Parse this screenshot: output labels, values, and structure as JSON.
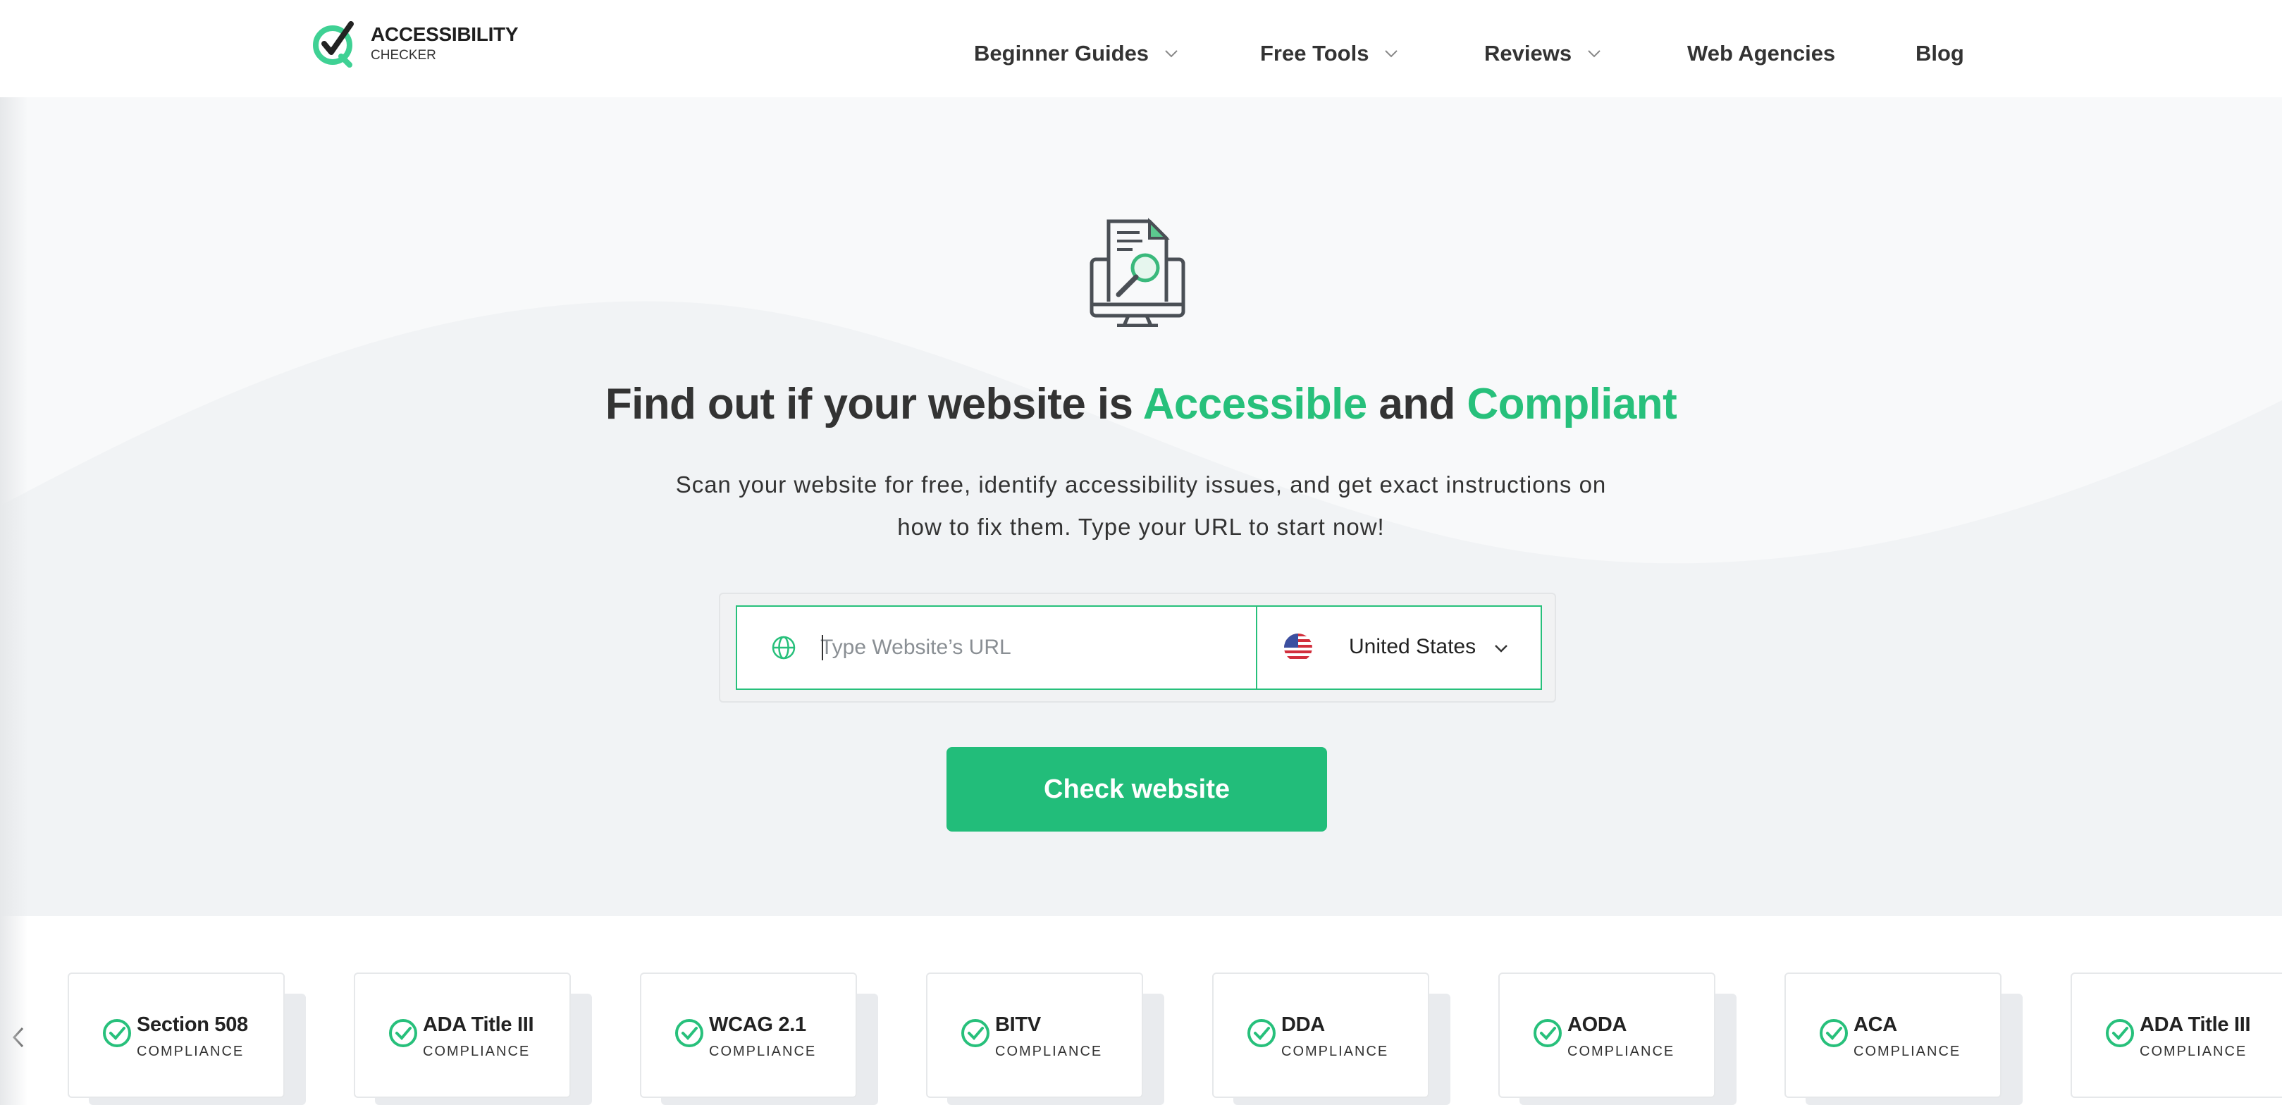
{
  "brand": {
    "title": "ACCESSIBILITY",
    "subtitle": "CHECKER",
    "logo_icon": "checkmark-q-logo",
    "accent": "#27c07b"
  },
  "nav": {
    "items": [
      {
        "label": "Beginner Guides",
        "dropdown": true
      },
      {
        "label": "Free Tools",
        "dropdown": true
      },
      {
        "label": "Reviews",
        "dropdown": true
      },
      {
        "label": "Web Agencies",
        "dropdown": false
      },
      {
        "label": "Blog",
        "dropdown": false
      }
    ]
  },
  "hero": {
    "icon": "monitor-document-search-icon",
    "headline_prefix": "Find out if your website is",
    "headline_accent1": "Accessible",
    "headline_mid": "and",
    "headline_accent2": "Compliant",
    "subtext_line1": "Scan your website for free, identify accessibility issues, and get exact instructions on",
    "subtext_line2": "how to fix them. Type your URL to start now!"
  },
  "form": {
    "url_placeholder": "Type Website’s URL",
    "url_value": "",
    "country": "United States",
    "country_flag": "us-flag-icon",
    "submit_label": "Check website"
  },
  "compliance": {
    "cards": [
      {
        "title": "Section 508",
        "subtitle": "COMPLIANCE"
      },
      {
        "title": "ADA Title III",
        "subtitle": "COMPLIANCE"
      },
      {
        "title": "WCAG 2.1",
        "subtitle": "COMPLIANCE"
      },
      {
        "title": "BITV",
        "subtitle": "COMPLIANCE"
      },
      {
        "title": "DDA",
        "subtitle": "COMPLIANCE"
      },
      {
        "title": "AODA",
        "subtitle": "COMPLIANCE"
      },
      {
        "title": "ACA",
        "subtitle": "COMPLIANCE"
      },
      {
        "title": "ADA Title III",
        "subtitle": "COMPLIANCE"
      }
    ]
  },
  "colors": {
    "primary_green": "#22bd7a",
    "text_dark": "#333333",
    "background": "#f8f9fa"
  }
}
